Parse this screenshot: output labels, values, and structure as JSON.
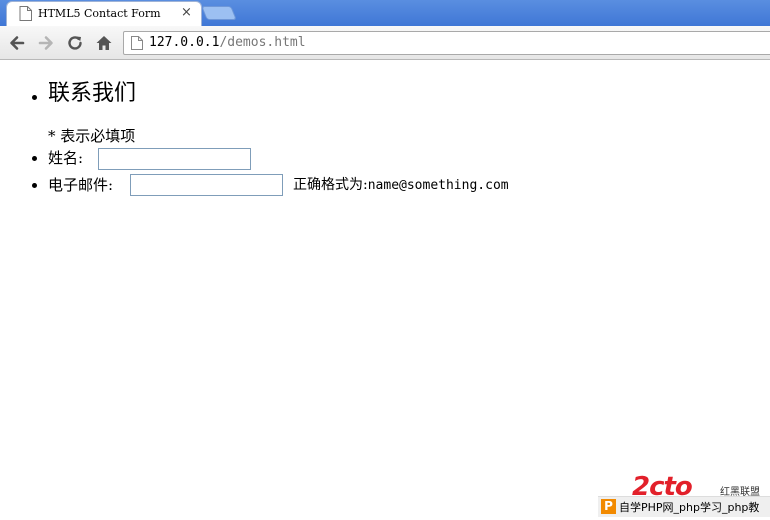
{
  "browser": {
    "tab_title": "HTML5 Contact Form",
    "tab_close": "×",
    "url_host": "127.0.0.1",
    "url_path": "/demos.html",
    "icons": [
      "back-icon",
      "forward-icon",
      "reload-icon",
      "home-icon",
      "page-icon"
    ]
  },
  "page": {
    "heading": "联系我们",
    "required_note": "* 表示必填项",
    "name_label": "姓名:",
    "name_value": "",
    "email_label": "电子邮件:",
    "email_value": "",
    "email_hint_prefix": "正确格式为:",
    "email_hint_example": "name@something.com"
  },
  "watermark": {
    "logo_text": "2cto",
    "logo_sub": "红黑联盟",
    "logo_color": "#e2202a",
    "badge_letter": "P",
    "bar_text": "自学PHP网_php学习_php教"
  }
}
